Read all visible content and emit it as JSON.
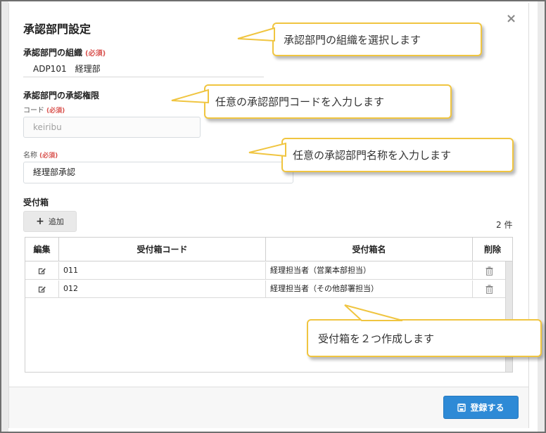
{
  "dialog": {
    "title": "承認部門設定",
    "close_symbol": "×"
  },
  "org": {
    "label": "承認部門の組織",
    "required": "(必須)",
    "code": "ADP101",
    "name": "経理部"
  },
  "authority": {
    "label": "承認部門の承認権限",
    "code_label": "コード",
    "code_required": "(必須)",
    "code_value": "keiribu",
    "name_label": "名称",
    "name_required": "(必須)",
    "name_value": "経理部承認"
  },
  "inbox": {
    "label": "受付箱",
    "add_label": "追加",
    "count": "2 件",
    "columns": [
      "編集",
      "受付箱コード",
      "受付箱名",
      "削除"
    ],
    "rows": [
      {
        "code": "011",
        "name": "経理担当者（営業本部担当）"
      },
      {
        "code": "012",
        "name": "経理担当者（その他部署担当）"
      }
    ]
  },
  "footer": {
    "register_label": "登録する"
  },
  "callouts": [
    "承認部門の組織を選択します",
    "任意の承認部門コードを入力します",
    "任意の承認部門名称を入力します",
    "受付箱を２つ作成します"
  ],
  "colors": {
    "accent": "#2e8ad6",
    "required": "#d9534f",
    "callout_border": "#f0c540"
  }
}
